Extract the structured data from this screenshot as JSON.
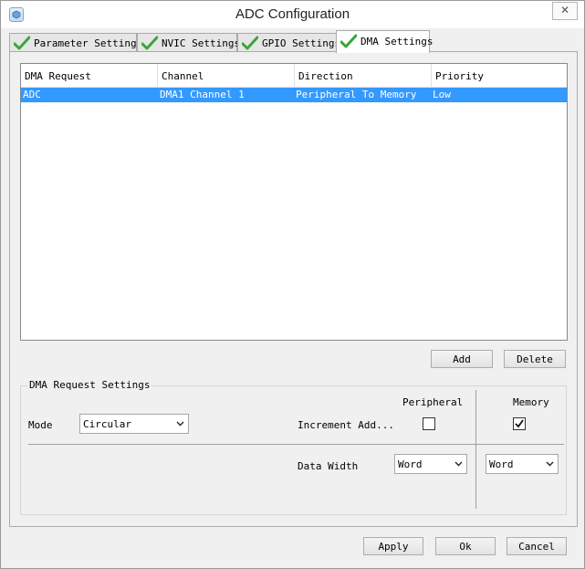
{
  "window": {
    "title": "ADC Configuration",
    "close_symbol": "✕"
  },
  "tabs": [
    {
      "label": "Parameter Settings",
      "icon": "check-icon",
      "active": false
    },
    {
      "label": "NVIC Settings",
      "icon": "check-icon",
      "active": false
    },
    {
      "label": "GPIO Settings",
      "icon": "check-icon",
      "active": false
    },
    {
      "label": "DMA Settings",
      "icon": "check-icon",
      "active": true
    }
  ],
  "dma_table": {
    "columns": [
      "DMA Request",
      "Channel",
      "Direction",
      "Priority"
    ],
    "rows": [
      {
        "request": "ADC",
        "channel": "DMA1 Channel 1",
        "direction": "Peripheral To Memory",
        "priority": "Low",
        "selected": true
      }
    ]
  },
  "table_buttons": {
    "add": "Add",
    "delete": "Delete"
  },
  "request_settings": {
    "legend": "DMA Request Settings",
    "mode_label": "Mode",
    "mode_value": "Circular",
    "peripheral_header": "Peripheral",
    "memory_header": "Memory",
    "increment_label": "Increment Add...",
    "increment_peripheral": false,
    "increment_memory": true,
    "data_width_label": "Data Width",
    "data_width_peripheral": "Word",
    "data_width_memory": "Word"
  },
  "footer": {
    "apply": "Apply",
    "ok": "Ok",
    "cancel": "Cancel"
  },
  "colors": {
    "selection": "#3399ff",
    "check_green": "#3aa53a",
    "window_bg": "#f0f0f0"
  }
}
